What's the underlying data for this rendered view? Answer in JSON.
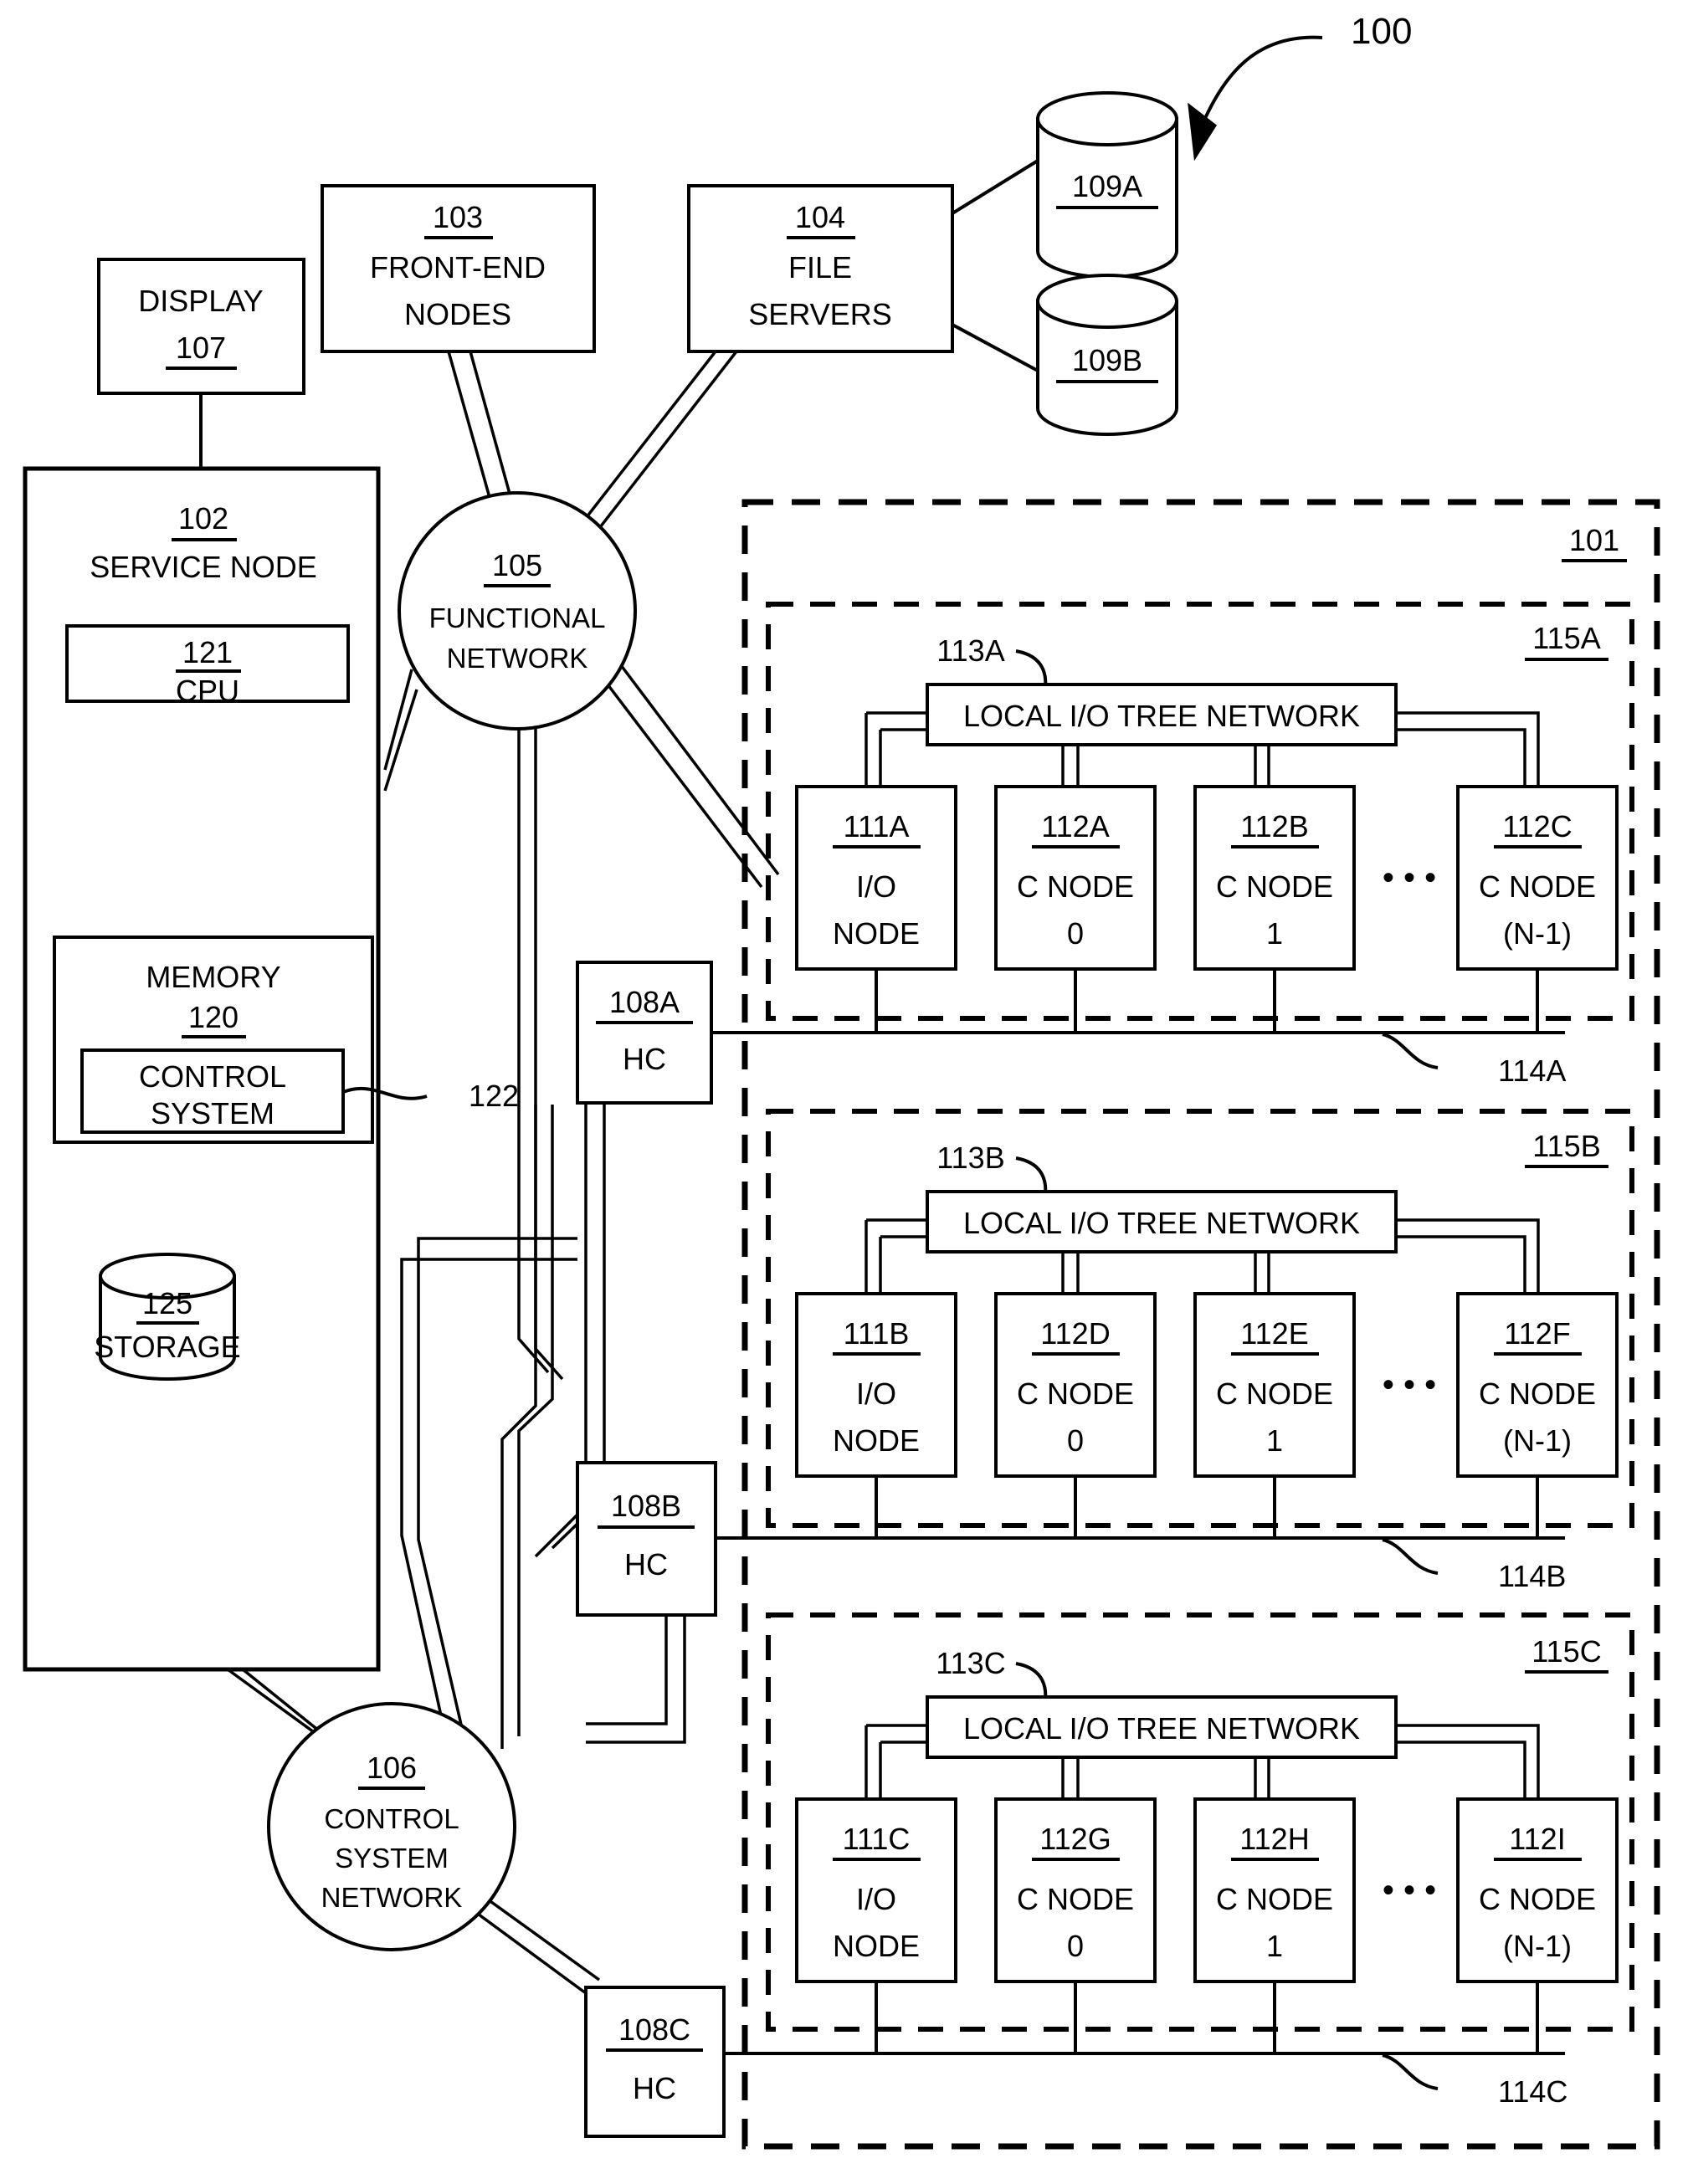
{
  "figure": {
    "number": "100",
    "system_ref": "101"
  },
  "nodes": {
    "display": {
      "ref": "107",
      "label": "DISPLAY"
    },
    "front_end": {
      "ref": "103",
      "line1": "FRONT-END",
      "line2": "NODES"
    },
    "file_servers": {
      "ref": "104",
      "line1": "FILE",
      "line2": "SERVERS"
    },
    "disk_a": {
      "ref": "109A"
    },
    "disk_b": {
      "ref": "109B"
    },
    "service_node": {
      "ref": "102",
      "label": "SERVICE NODE"
    },
    "cpu": {
      "ref": "121",
      "label": "CPU"
    },
    "memory": {
      "ref": "120",
      "label": "MEMORY"
    },
    "control_system": {
      "label1": "CONTROL",
      "label2": "SYSTEM",
      "ref": "122"
    },
    "storage": {
      "ref": "125",
      "label": "STORAGE"
    },
    "functional_network": {
      "ref": "105",
      "line1": "FUNCTIONAL",
      "line2": "NETWORK"
    },
    "control_system_network": {
      "ref": "106",
      "line1": "CONTROL",
      "line2": "SYSTEM",
      "line3": "NETWORK"
    }
  },
  "hardware_controllers": [
    {
      "ref": "108A",
      "label": "HC"
    },
    {
      "ref": "108B",
      "label": "HC"
    },
    {
      "ref": "108C",
      "label": "HC"
    }
  ],
  "racks": [
    {
      "ref": "115A",
      "tree_ref": "113A",
      "tree_label": "LOCAL I/O TREE NETWORK",
      "bus_ref": "114A",
      "ellipsis": "• • •",
      "cells": [
        {
          "ref": "111A",
          "line1": "I/O",
          "line2": "NODE"
        },
        {
          "ref": "112A",
          "line1": "C NODE",
          "line2": "0"
        },
        {
          "ref": "112B",
          "line1": "C NODE",
          "line2": "1"
        },
        {
          "ref": "112C",
          "line1": "C NODE",
          "line2": "(N-1)"
        }
      ]
    },
    {
      "ref": "115B",
      "tree_ref": "113B",
      "tree_label": "LOCAL I/O TREE NETWORK",
      "bus_ref": "114B",
      "ellipsis": "• • •",
      "cells": [
        {
          "ref": "111B",
          "line1": "I/O",
          "line2": "NODE"
        },
        {
          "ref": "112D",
          "line1": "C NODE",
          "line2": "0"
        },
        {
          "ref": "112E",
          "line1": "C NODE",
          "line2": "1"
        },
        {
          "ref": "112F",
          "line1": "C NODE",
          "line2": "(N-1)"
        }
      ]
    },
    {
      "ref": "115C",
      "tree_ref": "113C",
      "tree_label": "LOCAL I/O TREE NETWORK",
      "bus_ref": "114C",
      "ellipsis": "• • •",
      "cells": [
        {
          "ref": "111C",
          "line1": "I/O",
          "line2": "NODE"
        },
        {
          "ref": "112G",
          "line1": "C NODE",
          "line2": "0"
        },
        {
          "ref": "112H",
          "line1": "C NODE",
          "line2": "1"
        },
        {
          "ref": "112I",
          "line1": "C NODE",
          "line2": "(N-1)"
        }
      ]
    }
  ]
}
